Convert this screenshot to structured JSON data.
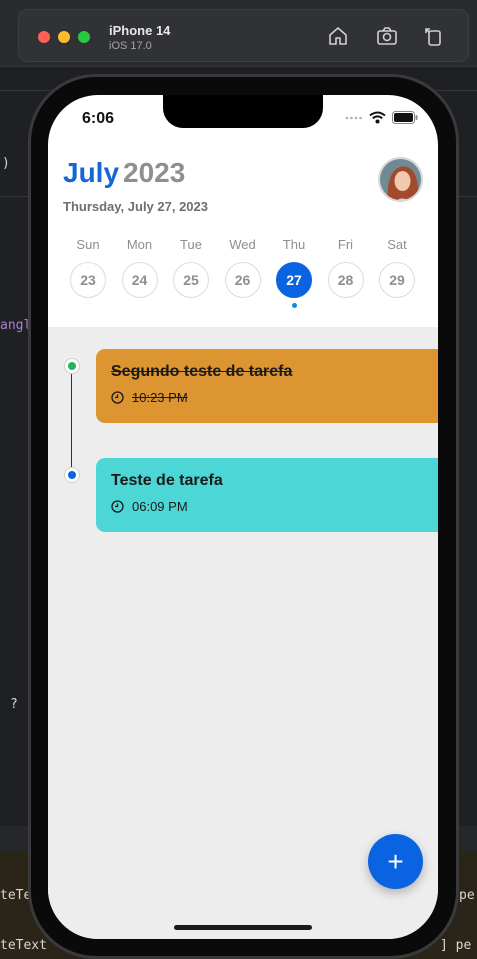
{
  "simulator": {
    "device_name": "iPhone 14",
    "os_version": "iOS 17.0",
    "icons": [
      "home-icon",
      "screenshot-icon",
      "rotate-icon"
    ]
  },
  "ide_fragments": {
    "paren": ")",
    "angle": "angl",
    "question": "?",
    "code_line_1": "teTe",
    "code_line_1_right": "pe",
    "code_line_2": "teText",
    "code_line_2_right": "] pe"
  },
  "status_bar": {
    "time": "6:06",
    "icons": [
      "signal-icon",
      "wifi-icon",
      "battery-icon"
    ]
  },
  "header": {
    "month": "July",
    "year": "2023",
    "full_date": "Thursday, July 27, 2023"
  },
  "week": {
    "days": [
      {
        "name": "Sun",
        "date": "23"
      },
      {
        "name": "Mon",
        "date": "24"
      },
      {
        "name": "Tue",
        "date": "25"
      },
      {
        "name": "Wed",
        "date": "26"
      },
      {
        "name": "Thu",
        "date": "27"
      },
      {
        "name": "Fri",
        "date": "28"
      },
      {
        "name": "Sat",
        "date": "29"
      }
    ],
    "selected_date": "27"
  },
  "tasks": [
    {
      "title": "Segundo teste de tarefa",
      "time": "10:23 PM",
      "completed": true,
      "color": "#dc9530",
      "dot_color": "#22b45c"
    },
    {
      "title": "Teste de tarefa",
      "time": "06:09 PM",
      "completed": false,
      "color": "#4dd6d6",
      "dot_color": "#0a63e0"
    }
  ],
  "fab": {
    "label": "+"
  },
  "colors": {
    "accent": "#0a63e0",
    "month": "#1566d6",
    "muted": "#8e8e93"
  }
}
